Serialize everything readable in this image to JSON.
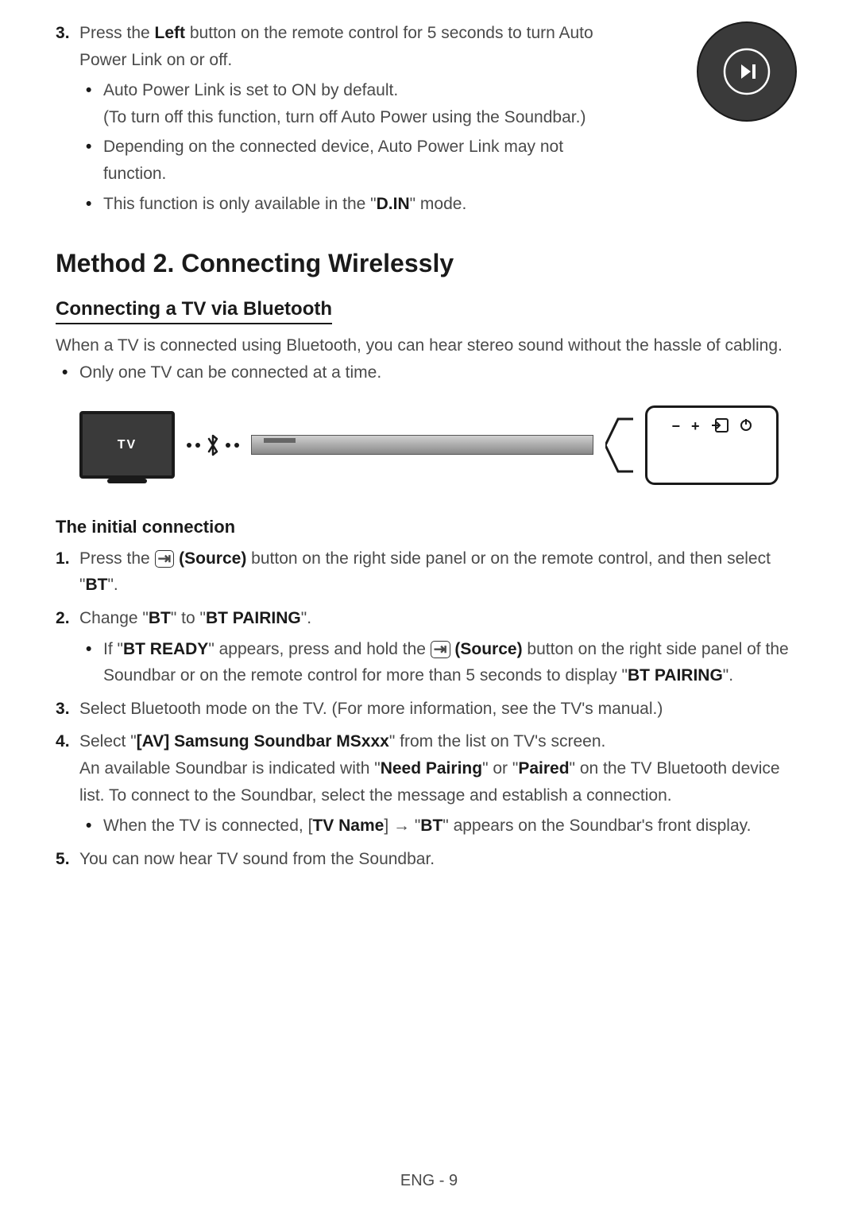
{
  "top_section": {
    "step3_number": "3",
    "step3_text_1": "Press the ",
    "step3_bold_1": "Left",
    "step3_text_2": " button on the remote control for 5 seconds to turn Auto Power Link on or off.",
    "bullets": [
      {
        "text_1": "Auto Power Link is set to ON by default.",
        "text_2": "(To turn off this function, turn off Auto Power using the Soundbar.)"
      },
      {
        "text_1": "Depending on the connected device, Auto Power Link may not function."
      },
      {
        "text_1": "This function is only available in the \"",
        "bold_1": "D.IN",
        "text_after": "\" mode."
      }
    ]
  },
  "method2": {
    "heading": "Method 2. Connecting Wirelessly",
    "subheading": "Connecting a TV via Bluetooth",
    "intro": "When a TV is connected using Bluetooth, you can hear stereo sound without the hassle of cabling.",
    "intro_bullet": "Only one TV can be connected at a time."
  },
  "diagram": {
    "tv_label": "TV",
    "panel_minus": "−",
    "panel_plus": "+"
  },
  "initial_connection": {
    "heading": "The initial connection",
    "steps": [
      {
        "num": "1",
        "text_1": "Press the ",
        "source_label": "(Source)",
        "text_2": " button on the right side panel or on the remote control, and then select \"",
        "bold_bt": "BT",
        "text_3": "\"."
      },
      {
        "num": "2",
        "text_1": "Change \"",
        "bold_1": "BT",
        "text_2": "\" to \"",
        "bold_2": "BT PAIRING",
        "text_3": "\".",
        "sub_bullet": {
          "text_1": "If \"",
          "bold_1": "BT READY",
          "text_2": "\" appears, press and hold the ",
          "source_label": "(Source)",
          "text_3": " button on the right side panel of the Soundbar or on the remote control for more than 5 seconds to display \"",
          "bold_2": "BT PAIRING",
          "text_4": "\"."
        }
      },
      {
        "num": "3",
        "text_1": "Select Bluetooth mode on the TV. (For more information, see the TV's manual.)"
      },
      {
        "num": "4",
        "text_1": "Select \"",
        "bold_1": "[AV] Samsung Soundbar MSxxx",
        "text_2": "\" from the list on TV's screen.",
        "line2_1": "An available Soundbar is indicated with \"",
        "line2_bold1": "Need Pairing",
        "line2_2": "\" or \"",
        "line2_bold2": "Paired",
        "line2_3": "\" on the TV Bluetooth device list. To connect to the Soundbar, select the message and establish a connection.",
        "sub_bullet": {
          "text_1": "When the TV is connected, [",
          "bold_1": "TV Name",
          "text_2": "] → \"",
          "bold_2": "BT",
          "text_3": "\" appears on the Soundbar's front display."
        }
      },
      {
        "num": "5",
        "text_1": "You can now hear TV sound from the Soundbar."
      }
    ]
  },
  "footer": "ENG - 9"
}
